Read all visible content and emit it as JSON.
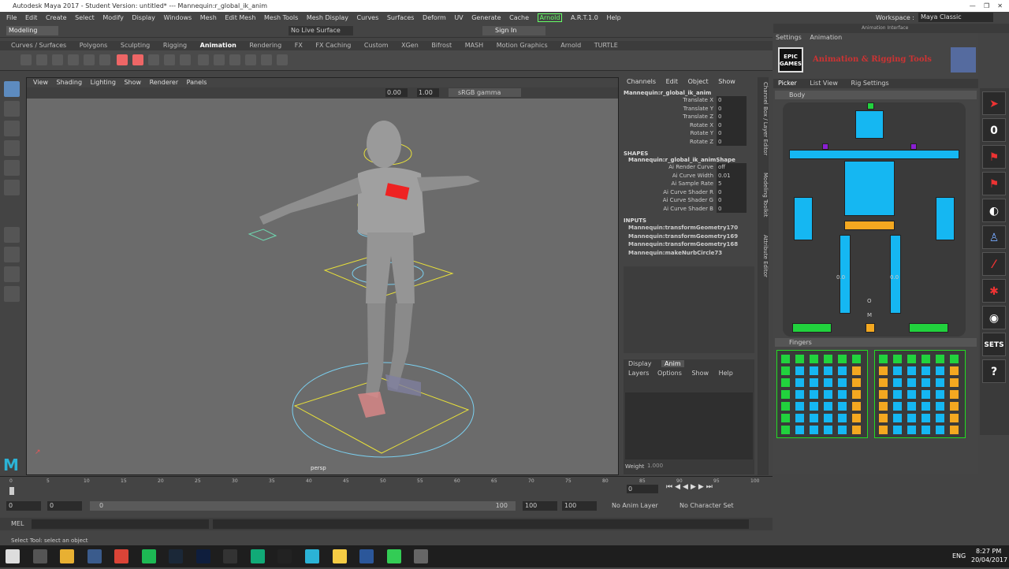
{
  "window": {
    "title": "Autodesk Maya 2017 - Student Version: untitled*   ---   Mannequin:r_global_ik_anim"
  },
  "menu": [
    "File",
    "Edit",
    "Create",
    "Select",
    "Modify",
    "Display",
    "Windows",
    "Mesh",
    "Edit Mesh",
    "Mesh Tools",
    "Mesh Display",
    "Curves",
    "Surfaces",
    "Deform",
    "UV",
    "Generate",
    "Cache",
    "Arnold",
    "A.R.T.1.0",
    "Help"
  ],
  "status": {
    "mode": "Modeling",
    "live_surface": "No Live Surface",
    "sign_in": "Sign In",
    "workspace_label": "Workspace :",
    "workspace_value": "Maya Classic"
  },
  "shelf_tabs": [
    "Curves / Surfaces",
    "Polygons",
    "Sculpting",
    "Rigging",
    "Animation",
    "Rendering",
    "FX",
    "FX Caching",
    "Custom",
    "XGen",
    "Bifrost",
    "MASH",
    "Motion Graphics",
    "Arnold",
    "TURTLE"
  ],
  "viewport": {
    "menus": [
      "View",
      "Shading",
      "Lighting",
      "Show",
      "Renderer",
      "Panels"
    ],
    "exposure": "0.00",
    "gamma": "1.00",
    "color_space": "sRGB gamma",
    "camera": "persp"
  },
  "channel_box": {
    "menus": [
      "Channels",
      "Edit",
      "Object",
      "Show"
    ],
    "node": "Mannequin:r_global_ik_anim",
    "attrs": [
      {
        "l": "Translate X",
        "v": "0"
      },
      {
        "l": "Translate Y",
        "v": "0"
      },
      {
        "l": "Translate Z",
        "v": "0"
      },
      {
        "l": "Rotate X",
        "v": "0"
      },
      {
        "l": "Rotate Y",
        "v": "0"
      },
      {
        "l": "Rotate Z",
        "v": "0"
      }
    ],
    "shapes_title": "SHAPES",
    "shape_node": "Mannequin:r_global_ik_animShape",
    "shape_attrs": [
      {
        "l": "Ai Render Curve",
        "v": "off"
      },
      {
        "l": "Ai Curve Width",
        "v": "0.01"
      },
      {
        "l": "Ai Sample Rate",
        "v": "5"
      },
      {
        "l": "Ai Curve Shader R",
        "v": "0"
      },
      {
        "l": "Ai Curve Shader G",
        "v": "0"
      },
      {
        "l": "Ai Curve Shader B",
        "v": "0"
      }
    ],
    "inputs_title": "INPUTS",
    "inputs": [
      "Mannequin:transformGeometry170",
      "Mannequin:transformGeometry169",
      "Mannequin:transformGeometry168",
      "Mannequin:makeNurbCircle73"
    ]
  },
  "layer_editor": {
    "tabs": [
      "Display",
      "Anim"
    ],
    "menus": [
      "Layers",
      "Options",
      "Show",
      "Help"
    ],
    "weight_label": "Weight",
    "weight_value": "1.000"
  },
  "side_tabs": [
    "Channel Box / Layer Editor",
    "Modeling Toolkit",
    "Attribute Editor"
  ],
  "picker": {
    "menus": [
      "Settings",
      "Animation"
    ],
    "title_label": "Animation Interface",
    "logo": "EPIC GAMES",
    "heading": "Animation & Rigging Tools",
    "tabs": [
      "Picker",
      "List View",
      "Rig Settings"
    ],
    "body_label": "Body",
    "fingers_label": "Fingers",
    "left_val": "0.0",
    "right_val": "0.0",
    "center_letters": [
      "O",
      "M"
    ]
  },
  "right_buttons": [
    "0",
    "SETS",
    "?"
  ],
  "timeline": {
    "ticks": [
      "0",
      "5",
      "10",
      "15",
      "20",
      "25",
      "30",
      "35",
      "40",
      "45",
      "50",
      "55",
      "60",
      "65",
      "70",
      "75",
      "80",
      "85",
      "90",
      "95",
      "100"
    ],
    "current": "0"
  },
  "range": {
    "start": "0",
    "start2": "0",
    "bar_start": "0",
    "bar_end": "100",
    "end": "100",
    "end2": "100",
    "anim_layer": "No Anim Layer",
    "character_set": "No Character Set"
  },
  "cmd": {
    "label": "MEL"
  },
  "help": "Select Tool: select an object",
  "taskbar": {
    "lang": "ENG",
    "time": "8:27 PM",
    "date": "20/04/2017"
  },
  "colors": {
    "cyan": "#15b7f2",
    "yellow": "#f4a820",
    "green": "#21d23d",
    "purple": "#8a1fd2"
  }
}
